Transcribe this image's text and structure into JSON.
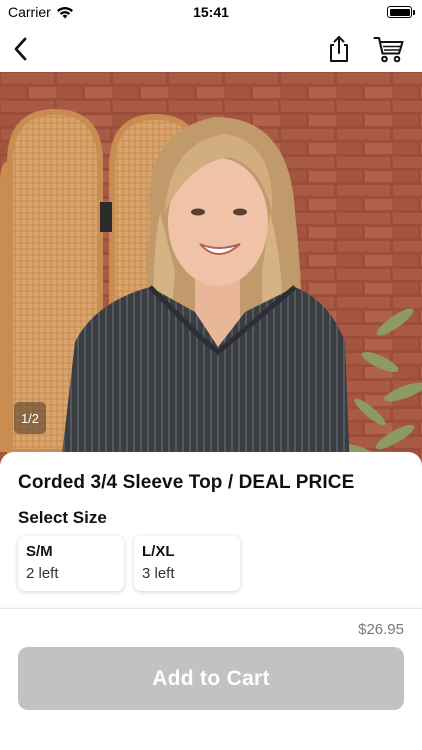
{
  "status_bar": {
    "carrier": "Carrier",
    "time": "15:41"
  },
  "nav": {
    "back_icon": "chevron-left-icon",
    "share_icon": "share-icon",
    "cart_icon": "cart-icon"
  },
  "gallery": {
    "page_indicator": "1/2",
    "image_description": "model-photo"
  },
  "product": {
    "title": "Corded 3/4 Sleeve Top / DEAL PRICE",
    "size_heading": "Select Size",
    "sizes": [
      {
        "name": "S/M",
        "stock": "2 left"
      },
      {
        "name": "L/XL",
        "stock": "3 left"
      }
    ]
  },
  "purchase": {
    "price": "$26.95",
    "add_to_cart_label": "Add to Cart"
  },
  "colors": {
    "button_disabled": "#c2c2c2",
    "price_text": "#777777"
  }
}
